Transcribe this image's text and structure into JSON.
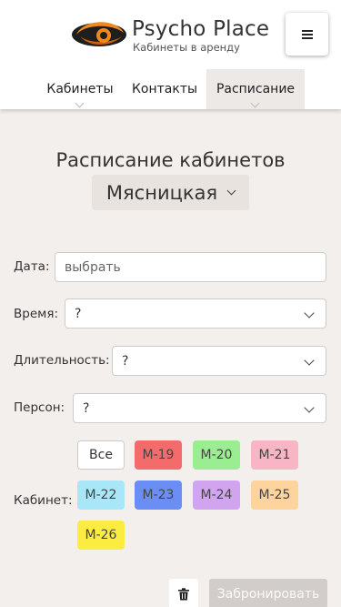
{
  "header": {
    "brand_title": "Psycho Place",
    "brand_subtitle": "Кабинеты в аренду",
    "menu_icon": "hamburger-icon"
  },
  "nav": {
    "tabs": [
      {
        "label": "Кабинеты",
        "active": false
      },
      {
        "label": "Контакты",
        "active": false
      },
      {
        "label": "Расписание",
        "active": true
      }
    ]
  },
  "main": {
    "title": "Расписание кабинетов",
    "location": "Мясницкая"
  },
  "form": {
    "date_label": "Дата:",
    "date_placeholder": "выбрать",
    "time_label": "Время:",
    "time_value": "?",
    "duration_label": "Длительность:",
    "duration_value": "?",
    "persons_label": "Персон:",
    "persons_value": "?",
    "room_label": "Кабинет:",
    "rooms": [
      {
        "label": "Все",
        "color": "#ffffff"
      },
      {
        "label": "М-19",
        "color": "#f36b6b"
      },
      {
        "label": "М-20",
        "color": "#9bed91"
      },
      {
        "label": "М-21",
        "color": "#f8b5c4"
      },
      {
        "label": "М-22",
        "color": "#a9e7f8"
      },
      {
        "label": "М-23",
        "color": "#6b8ef5"
      },
      {
        "label": "М-24",
        "color": "#d0a4ee"
      },
      {
        "label": "М-25",
        "color": "#fdd39e"
      },
      {
        "label": "М-26",
        "color": "#fbec42"
      }
    ]
  },
  "actions": {
    "trash_icon": "trash-icon",
    "book_label": "Забронировать"
  },
  "colors": {
    "background": "#f3efed",
    "book_button_disabled": "#d2cdca",
    "logo_orange": "#ee8a1d"
  }
}
